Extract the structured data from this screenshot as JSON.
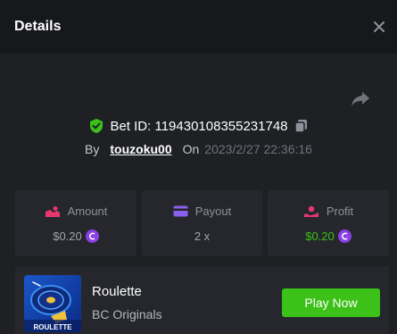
{
  "header": {
    "title": "Details"
  },
  "bet": {
    "label": "Bet ID: 119430108355231748"
  },
  "byline": {
    "by_label": "By",
    "username": "touzoku00",
    "on_label": "On",
    "timestamp": "2023/2/27 22:36:16"
  },
  "stats": {
    "amount": {
      "label": "Amount",
      "value": "$0.20"
    },
    "payout": {
      "label": "Payout",
      "value": "2 x"
    },
    "profit": {
      "label": "Profit",
      "value": "$0.20"
    }
  },
  "game": {
    "name": "Roulette",
    "provider": "BC Originals",
    "thumb_label": "ROULETTE",
    "play_label": "Play Now"
  },
  "icons": {
    "close": "close-icon",
    "share": "share-icon",
    "shield": "shield-check-icon",
    "copy": "copy-icon",
    "amount": "amount-icon",
    "payout": "card-icon",
    "profit": "profit-icon",
    "coin": "coin-icon"
  },
  "colors": {
    "accent_green": "#3bc117",
    "amount_pink": "#e8386f",
    "payout_purple": "#8b5ff0",
    "profit_red": "#e8386f",
    "coin_purple": "#8b3fe6"
  }
}
